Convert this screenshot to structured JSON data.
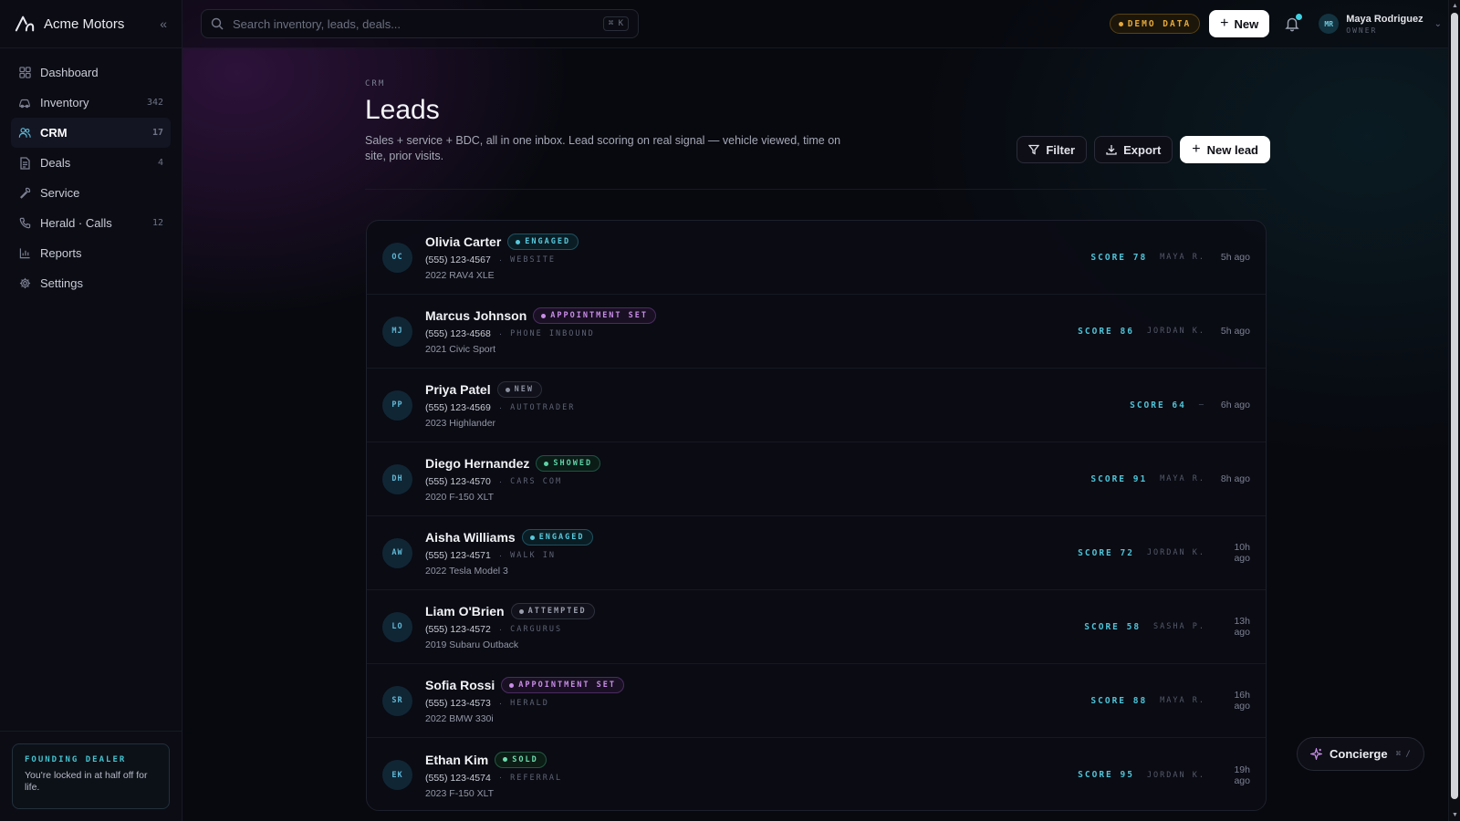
{
  "brand": {
    "name": "Acme Motors",
    "collapse_icon": "double-chevron-left-icon"
  },
  "sidebar": {
    "items": [
      {
        "label": "Dashboard",
        "icon": "dashboard-grid-icon",
        "count": ""
      },
      {
        "label": "Inventory",
        "icon": "car-icon",
        "count": "342"
      },
      {
        "label": "CRM",
        "icon": "users-icon",
        "count": "17",
        "active": true
      },
      {
        "label": "Deals",
        "icon": "document-icon",
        "count": "4"
      },
      {
        "label": "Service",
        "icon": "wrench-icon",
        "count": ""
      },
      {
        "label": "Herald · Calls",
        "icon": "phone-icon",
        "count": "12"
      },
      {
        "label": "Reports",
        "icon": "bar-chart-icon",
        "count": ""
      },
      {
        "label": "Settings",
        "icon": "gear-icon",
        "count": ""
      }
    ],
    "founding": {
      "title": "FOUNDING DEALER",
      "text": "You're locked in at half off for life."
    }
  },
  "topbar": {
    "search": {
      "placeholder": "Search inventory, leads, deals...",
      "shortcut": "⌘ K"
    },
    "demo_badge": "DEMO DATA",
    "new_label": "New",
    "user": {
      "initials": "MR",
      "name": "Maya Rodriguez",
      "role": "OWNER"
    }
  },
  "page": {
    "breadcrumb": "CRM",
    "title": "Leads",
    "description": "Sales + service + BDC, all in one inbox. Lead scoring on real signal — vehicle viewed, time on site, prior visits.",
    "actions": {
      "filter": "Filter",
      "export": "Export",
      "new_lead": "New lead"
    }
  },
  "leads": [
    {
      "initials": "OC",
      "name": "Olivia Carter",
      "status": "ENGAGED",
      "status_kind": "engaged",
      "phone": "(555) 123-4567",
      "source": "WEBSITE",
      "vehicle": "2022 RAV4 XLE",
      "score": "SCORE 78",
      "owner": "MAYA R.",
      "time": "5h ago"
    },
    {
      "initials": "MJ",
      "name": "Marcus Johnson",
      "status": "APPOINTMENT SET",
      "status_kind": "appointment",
      "phone": "(555) 123-4568",
      "source": "PHONE INBOUND",
      "vehicle": "2021 Civic Sport",
      "score": "SCORE 86",
      "owner": "JORDAN K.",
      "time": "5h ago"
    },
    {
      "initials": "PP",
      "name": "Priya Patel",
      "status": "NEW",
      "status_kind": "new",
      "phone": "(555) 123-4569",
      "source": "AUTOTRADER",
      "vehicle": "2023 Highlander",
      "score": "SCORE 64",
      "owner": "—",
      "time": "6h ago"
    },
    {
      "initials": "DH",
      "name": "Diego Hernandez",
      "status": "SHOWED",
      "status_kind": "showed",
      "phone": "(555) 123-4570",
      "source": "CARS COM",
      "vehicle": "2020 F-150 XLT",
      "score": "SCORE 91",
      "owner": "MAYA R.",
      "time": "8h ago"
    },
    {
      "initials": "AW",
      "name": "Aisha Williams",
      "status": "ENGAGED",
      "status_kind": "engaged",
      "phone": "(555) 123-4571",
      "source": "WALK IN",
      "vehicle": "2022 Tesla Model 3",
      "score": "SCORE 72",
      "owner": "JORDAN K.",
      "time": "10h ago"
    },
    {
      "initials": "LO",
      "name": "Liam O'Brien",
      "status": "ATTEMPTED",
      "status_kind": "attempted",
      "phone": "(555) 123-4572",
      "source": "CARGURUS",
      "vehicle": "2019 Subaru Outback",
      "score": "SCORE 58",
      "owner": "SASHA P.",
      "time": "13h ago"
    },
    {
      "initials": "SR",
      "name": "Sofia Rossi",
      "status": "APPOINTMENT SET",
      "status_kind": "appointment",
      "phone": "(555) 123-4573",
      "source": "HERALD",
      "vehicle": "2022 BMW 330i",
      "score": "SCORE 88",
      "owner": "MAYA R.",
      "time": "16h ago"
    },
    {
      "initials": "EK",
      "name": "Ethan Kim",
      "status": "SOLD",
      "status_kind": "sold",
      "phone": "(555) 123-4574",
      "source": "REFERRAL",
      "vehicle": "2023 F-150 XLT",
      "score": "SCORE 95",
      "owner": "JORDAN K.",
      "time": "19h ago"
    }
  ],
  "concierge": {
    "label": "Concierge",
    "shortcut": "⌘ /"
  },
  "colors": {
    "accent": "#4fc3d7",
    "brand_bg": "#08090f",
    "demo": "#e5a83a"
  }
}
